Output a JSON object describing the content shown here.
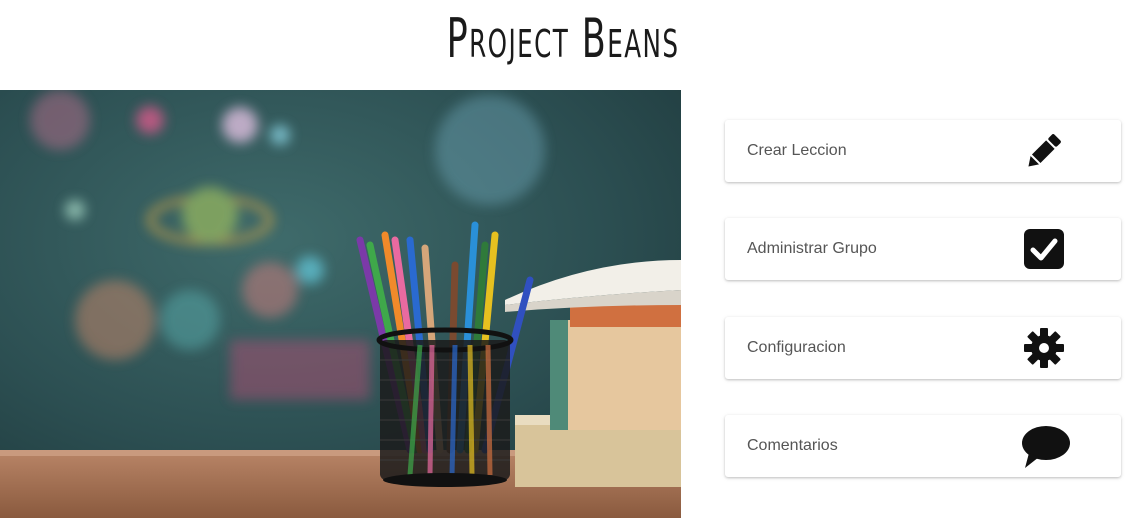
{
  "header": {
    "title": "Project Beans"
  },
  "hero": {
    "image_description": "pencils-and-books-classroom"
  },
  "menu": {
    "items": [
      {
        "label": "Crear Leccion",
        "icon": "pencil-icon"
      },
      {
        "label": "Administrar Grupo",
        "icon": "checkbox-icon"
      },
      {
        "label": "Configuracion",
        "icon": "gear-icon"
      },
      {
        "label": "Comentarios",
        "icon": "speech-bubble-icon"
      }
    ]
  },
  "colors": {
    "icon": "#111111",
    "label_text": "#555555",
    "card_bg": "#ffffff",
    "chalkboard": "#2f5456"
  }
}
